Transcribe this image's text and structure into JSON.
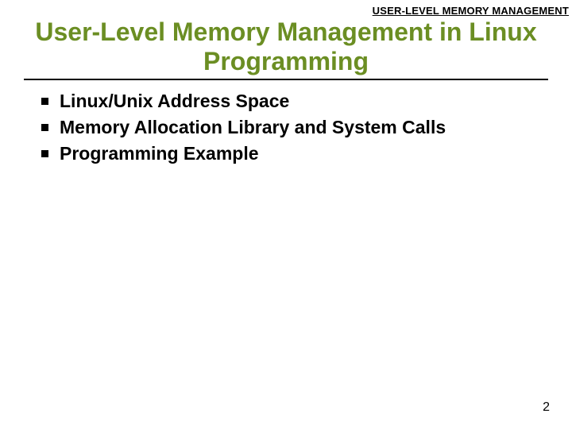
{
  "header": {
    "label": "USER-LEVEL MEMORY MANAGEMENT"
  },
  "title": "User-Level Memory Management in Linux Programming",
  "bullets": {
    "b0": "Linux/Unix Address Space",
    "b1": "Memory Allocation Library and System Calls",
    "b2": "Programming Example"
  },
  "page_number": "2"
}
